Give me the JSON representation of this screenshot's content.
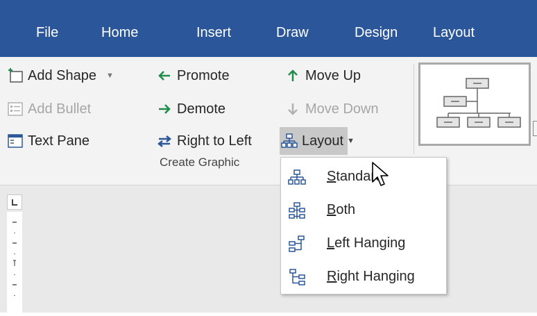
{
  "ribbon_tabs": [
    "File",
    "Home",
    "Insert",
    "Draw",
    "Design",
    "Layout"
  ],
  "create_graphic": {
    "add_shape": "Add Shape",
    "add_bullet": "Add Bullet",
    "text_pane": "Text Pane",
    "promote": "Promote",
    "demote": "Demote",
    "right_to_left": "Right to Left",
    "move_up": "Move Up",
    "move_down": "Move Down",
    "layout": "Layout",
    "group_label": "Create Graphic"
  },
  "layout_menu": {
    "items": [
      {
        "accel": "S",
        "rest": "tandard"
      },
      {
        "accel": "B",
        "rest": "oth"
      },
      {
        "accel": "L",
        "rest": "eft Hanging"
      },
      {
        "accel": "R",
        "rest": "ight Hanging"
      }
    ]
  },
  "icons": {
    "add_shape": "add-shape-icon",
    "add_bullet": "bullet-list-icon",
    "text_pane": "text-pane-icon",
    "promote": "arrow-left-icon",
    "demote": "arrow-right-icon",
    "right_to_left": "swap-arrows-icon",
    "move_up": "arrow-up-icon",
    "move_down": "arrow-down-icon",
    "layout": "org-chart-icon"
  },
  "colors": {
    "ribbon_blue": "#2b579a",
    "ribbon_bg": "#f3f3f3",
    "green_arrow": "#1e8c4b",
    "icon_blue": "#2b579a",
    "hover_gray": "#c8c8c8"
  }
}
